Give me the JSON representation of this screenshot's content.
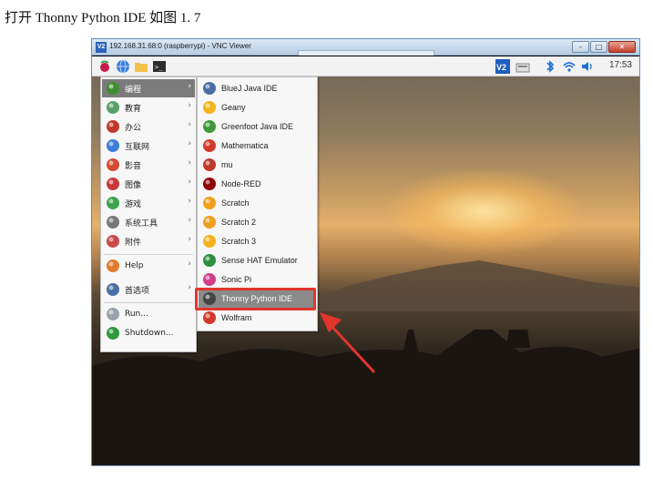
{
  "caption": "打开 Thonny Python IDE 如图 1. 7",
  "window": {
    "title": "192.168.31.68:0 (raspberrypi) - VNC Viewer",
    "app_icon": "V2",
    "controls": {
      "minimize": "–",
      "maximize": "□",
      "close": "✕"
    }
  },
  "panel": {
    "icons": [
      "raspberry-menu-icon",
      "web-browser-icon",
      "file-manager-icon",
      "terminal-icon",
      "vnc-server-icon",
      "keyboard-icon",
      "bluetooth-icon",
      "wifi-icon",
      "volume-icon"
    ],
    "vnc_label": "V2",
    "clock": "17:53"
  },
  "main_menu": [
    {
      "label": "编程",
      "icon": "programming-icon",
      "color": "#3f8f2f",
      "submenu": true,
      "active": true
    },
    {
      "label": "教育",
      "icon": "education-icon",
      "color": "#5aa06a",
      "submenu": true
    },
    {
      "label": "办公",
      "icon": "office-icon",
      "color": "#c0392b",
      "submenu": true
    },
    {
      "label": "互联网",
      "icon": "internet-icon",
      "color": "#3b7dd8",
      "submenu": true
    },
    {
      "label": "影音",
      "icon": "sound-video-icon",
      "color": "#d44a33",
      "submenu": true
    },
    {
      "label": "图像",
      "icon": "graphics-icon",
      "color": "#c7393a",
      "submenu": true
    },
    {
      "label": "游戏",
      "icon": "games-icon",
      "color": "#3fa34d",
      "submenu": true
    },
    {
      "label": "系统工具",
      "icon": "system-tools-icon",
      "color": "#777777",
      "submenu": true
    },
    {
      "label": "附件",
      "icon": "accessories-icon",
      "color": "#c94a4a",
      "submenu": true
    },
    {
      "label": "Help",
      "icon": "help-icon",
      "color": "#e07b2a",
      "submenu": true
    },
    {
      "label": "首选项",
      "icon": "preferences-icon",
      "color": "#4a6fa5",
      "submenu": true
    },
    {
      "label": "Run...",
      "icon": "run-icon",
      "color": "#9aa3ad",
      "submenu": false
    },
    {
      "label": "Shutdown...",
      "icon": "shutdown-icon",
      "color": "#2e9a3a",
      "submenu": false
    }
  ],
  "sub_menu": [
    {
      "label": "BlueJ Java IDE",
      "icon": "bluej-icon",
      "color": "#4a6fa5"
    },
    {
      "label": "Geany",
      "icon": "geany-icon",
      "color": "#f2b51c"
    },
    {
      "label": "Greenfoot Java IDE",
      "icon": "greenfoot-icon",
      "color": "#3f9a3a"
    },
    {
      "label": "Mathematica",
      "icon": "mathematica-icon",
      "color": "#d33a2c"
    },
    {
      "label": "mu",
      "icon": "mu-icon",
      "color": "#c0392b"
    },
    {
      "label": "Node-RED",
      "icon": "node-red-icon",
      "color": "#8f0000"
    },
    {
      "label": "Scratch",
      "icon": "scratch-icon",
      "color": "#f29f1c"
    },
    {
      "label": "Scratch 2",
      "icon": "scratch2-icon",
      "color": "#f29f1c"
    },
    {
      "label": "Scratch 3",
      "icon": "scratch3-icon",
      "color": "#f4b31a"
    },
    {
      "label": "Sense HAT Emulator",
      "icon": "sense-hat-icon",
      "color": "#2f8f3f"
    },
    {
      "label": "Sonic Pi",
      "icon": "sonic-pi-icon",
      "color": "#d13e8a"
    },
    {
      "label": "Thonny Python IDE",
      "icon": "thonny-icon",
      "color": "#444444",
      "highlighted": true
    },
    {
      "label": "Wolfram",
      "icon": "wolfram-icon",
      "color": "#d33a2c"
    }
  ],
  "colors": {
    "highlight_box": "#e3342c",
    "arrow": "#e3342c",
    "active_item": "#7b7b7b"
  }
}
